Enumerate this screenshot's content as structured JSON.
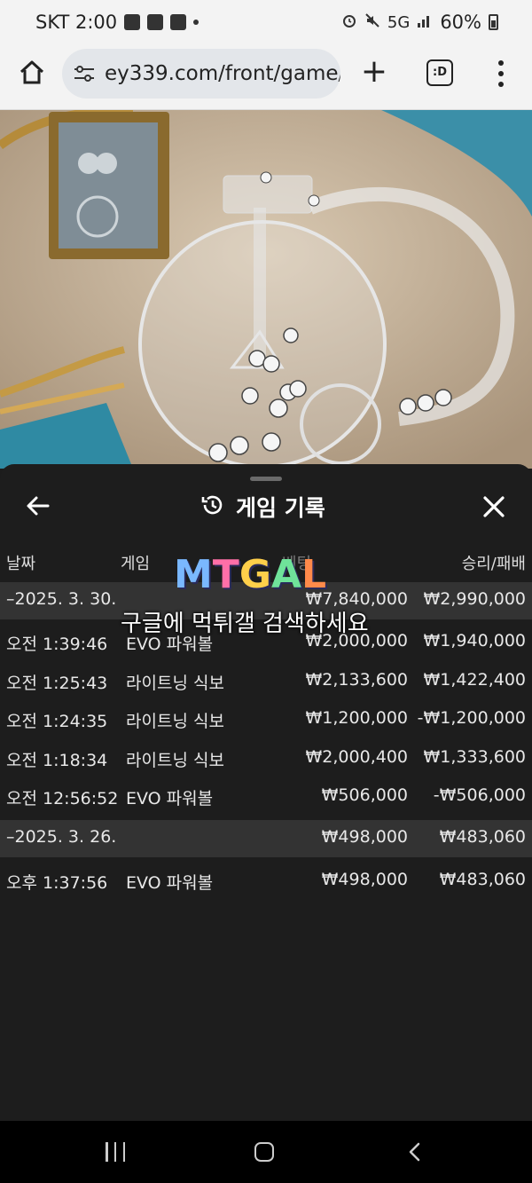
{
  "status_bar": {
    "carrier_time": "SKT 2:00",
    "network": "5G",
    "battery": "60%"
  },
  "browser": {
    "url": "ey339.com/front/game/",
    "tabs_label": ":D",
    "icons": [
      "home-icon",
      "site-settings-icon",
      "new-tab-icon",
      "tabs-icon",
      "more-menu-icon"
    ]
  },
  "panel": {
    "title": "게임 기록",
    "columns": {
      "date": "날짜",
      "game": "게임",
      "bet": "베팅",
      "result": "승리/패배"
    },
    "rows": [
      {
        "type": "day",
        "time": "–2025. 3. 30.",
        "game": "",
        "bet": "₩7,840,000",
        "result": "₩2,990,000"
      },
      {
        "type": "entry",
        "time": "오전 1:39:46",
        "game": "EVO 파워볼",
        "bet": "₩2,000,000",
        "result": "₩1,940,000"
      },
      {
        "type": "entry",
        "time": "오전 1:25:43",
        "game": "라이트닝 식보",
        "bet": "₩2,133,600",
        "result": "₩1,422,400"
      },
      {
        "type": "entry",
        "time": "오전 1:24:35",
        "game": "라이트닝 식보",
        "bet": "₩1,200,000",
        "result": "-₩1,200,000"
      },
      {
        "type": "entry",
        "time": "오전 1:18:34",
        "game": "라이트닝 식보",
        "bet": "₩2,000,400",
        "result": "₩1,333,600"
      },
      {
        "type": "entry",
        "time": "오전 12:56:52",
        "game": "EVO 파워볼",
        "bet": "₩506,000",
        "result": "-₩506,000"
      },
      {
        "type": "day",
        "time": "–2025. 3. 26.",
        "game": "",
        "bet": "₩498,000",
        "result": "₩483,060"
      },
      {
        "type": "entry",
        "time": "오후 1:37:56",
        "game": "EVO 파워볼",
        "bet": "₩498,000",
        "result": "₩483,060"
      }
    ]
  },
  "watermark": {
    "logo": "MTGAL",
    "caption": "구글에 먹튀갤 검색하세요",
    "logo_colors": [
      "#7ab8ff",
      "#ff6fa8",
      "#ffcf4a",
      "#6fe39a",
      "#ff8a4a"
    ]
  },
  "colors": {
    "panel_bg": "#1d1d1d",
    "day_row_bg": "#333333",
    "browser_bg": "#f3f3f3"
  }
}
